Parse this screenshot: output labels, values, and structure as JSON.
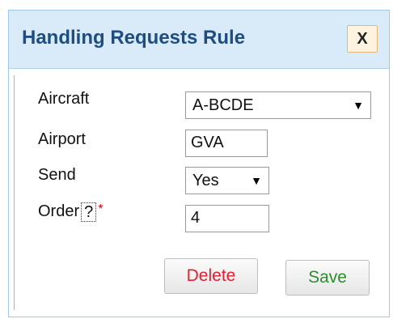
{
  "dialog": {
    "title": "Handling Requests Rule",
    "close_label": "X"
  },
  "form": {
    "aircraft": {
      "label": "Aircraft",
      "value": "A-BCDE"
    },
    "airport": {
      "label": "Airport",
      "value": "GVA"
    },
    "send": {
      "label": "Send",
      "value": "Yes"
    },
    "order": {
      "label": "Order",
      "help": "?",
      "required_mark": "*",
      "value": "4"
    }
  },
  "actions": {
    "delete_label": "Delete",
    "save_label": "Save"
  },
  "colors": {
    "title": "#1d4d82",
    "delete": "#e0202f",
    "save": "#2f8a2f",
    "required": "#d40000"
  },
  "icons": {
    "dropdown": "caret-down-icon"
  }
}
